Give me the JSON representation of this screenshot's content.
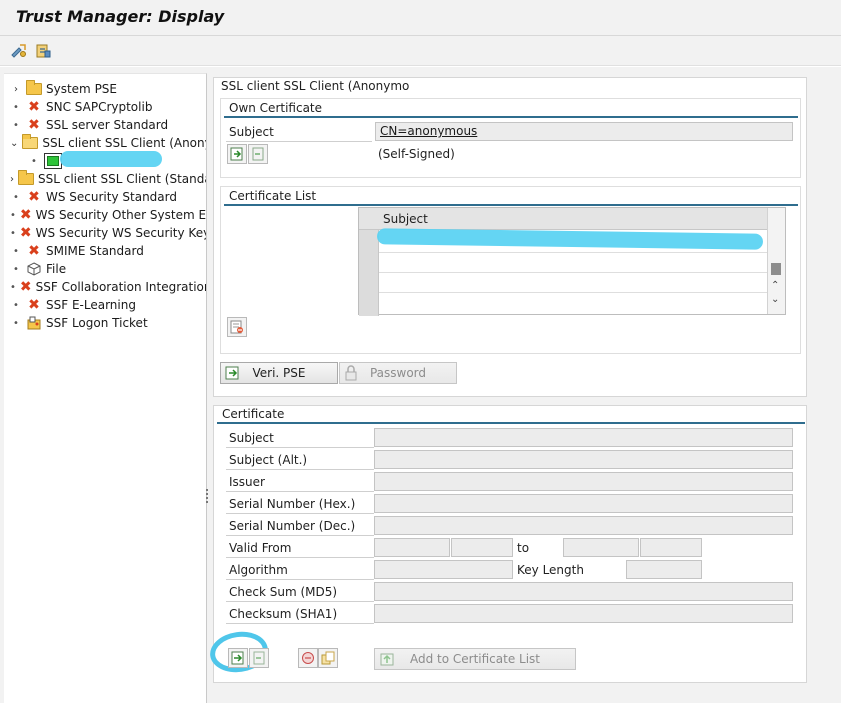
{
  "window": {
    "title": "Trust Manager: Display"
  },
  "toolbar": {
    "icons": [
      "edit-pse-icon",
      "display-icon"
    ]
  },
  "tree": {
    "items": [
      {
        "label": "System PSE",
        "icon": "folder-icon",
        "expander": "›"
      },
      {
        "label": "SNC SAPCryptolib",
        "icon": "error-x-icon",
        "expander": "•"
      },
      {
        "label": "SSL server Standard",
        "icon": "error-x-icon",
        "expander": "•"
      },
      {
        "label": "SSL client SSL Client (Anonymous)",
        "icon": "folder-open-icon",
        "expander": "⌄"
      },
      {
        "label": "",
        "icon": "certificate-green-icon",
        "expander": "•"
      },
      {
        "label": "SSL client SSL Client (Standard)",
        "icon": "folder-icon",
        "expander": "›"
      },
      {
        "label": "WS Security Standard",
        "icon": "error-x-icon",
        "expander": "•"
      },
      {
        "label": "WS Security Other System Encryption",
        "icon": "error-x-icon",
        "expander": "•"
      },
      {
        "label": "WS Security WS Security Keys",
        "icon": "error-x-icon",
        "expander": "•"
      },
      {
        "label": "SMIME Standard",
        "icon": "error-x-icon",
        "expander": "•"
      },
      {
        "label": "File",
        "icon": "file-cube-icon",
        "expander": "•"
      },
      {
        "label": "SSF Collaboration Integration",
        "icon": "error-x-icon",
        "expander": "•"
      },
      {
        "label": "SSF E-Learning",
        "icon": "error-x-icon",
        "expander": "•"
      },
      {
        "label": "SSF Logon Ticket",
        "icon": "logon-ticket-icon",
        "expander": "•"
      }
    ]
  },
  "pse_panel": {
    "title": "SSL client SSL Client (Anonymo",
    "own_certificate": {
      "group_title": "Own Certificate",
      "subject_label": "Subject",
      "subject_value": "CN=anonymous",
      "status": "(Self-Signed)"
    },
    "certificate_list": {
      "group_title": "Certificate List",
      "column_subject": "Subject"
    },
    "buttons": {
      "veri_pse": "Veri. PSE",
      "password": "Password"
    }
  },
  "certificate_panel": {
    "group_title": "Certificate",
    "labels": {
      "subject": "Subject",
      "subject_alt": "Subject (Alt.)",
      "issuer": "Issuer",
      "serial_hex": "Serial Number (Hex.)",
      "serial_dec": "Serial Number (Dec.)",
      "valid_from": "Valid From",
      "to": "to",
      "algorithm": "Algorithm",
      "key_length": "Key Length",
      "checksum_md5": "Check Sum (MD5)",
      "checksum_sha1": "Checksum (SHA1)"
    },
    "buttons": {
      "add_to_list": "Add to Certificate List"
    }
  },
  "colors": {
    "accent_line": "#2f6d8e",
    "error_x": "#d9401c",
    "folder": "#f5c64a",
    "redaction": "#5cd3f2"
  }
}
